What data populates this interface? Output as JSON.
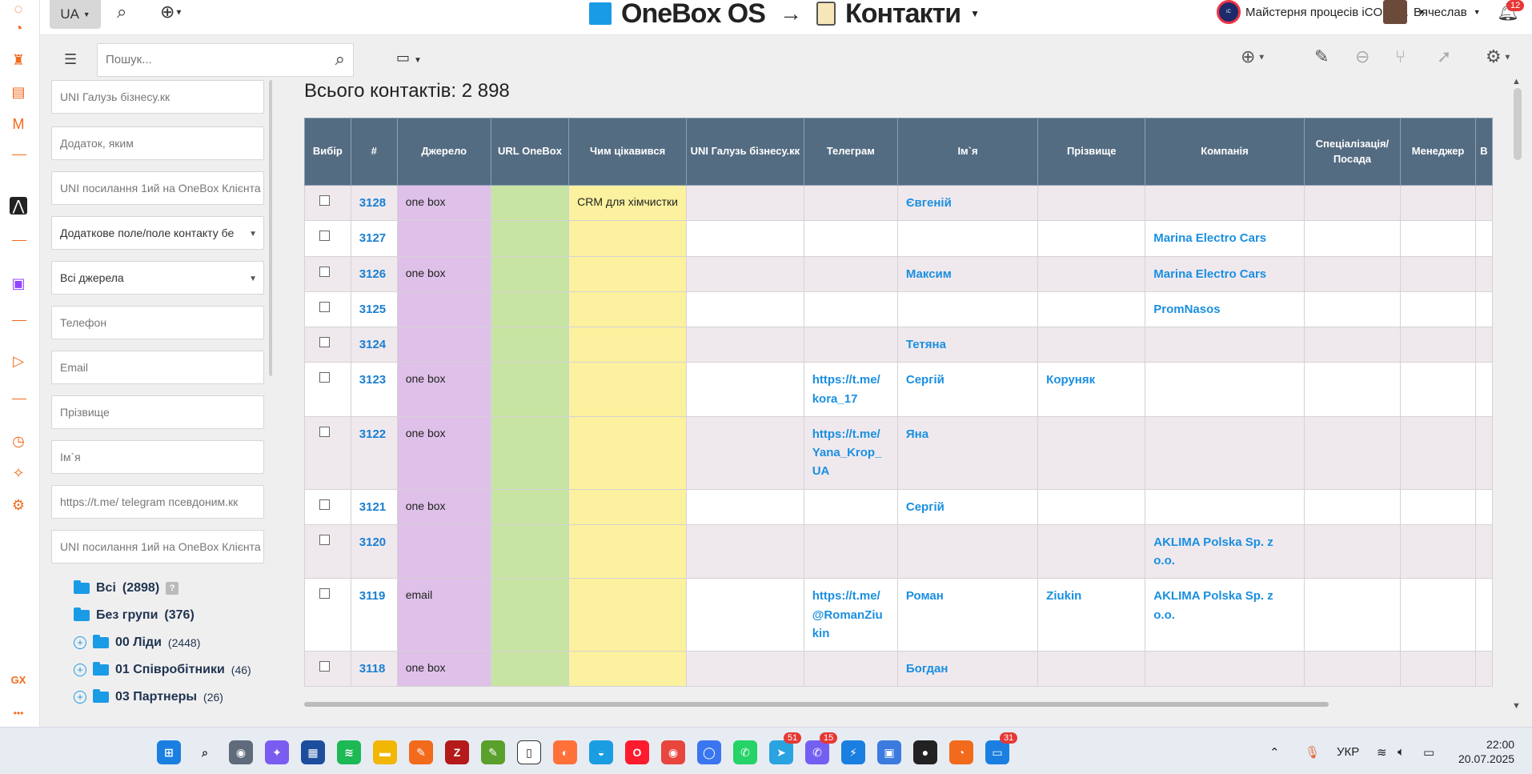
{
  "left_rail": {
    "icons": [
      "dashboard-icon",
      "speed-icon",
      "bag-icon",
      "stripe-icon",
      "mail-icon",
      "logo-icon",
      "twitch-icon",
      "play-icon",
      "clock-icon",
      "puzzle-icon",
      "settings-icon"
    ],
    "bottom_label": "GX",
    "more": "•••"
  },
  "topbar": {
    "lang": "UA",
    "app_name": "OneBox OS",
    "arrow": "→",
    "module": "Контакти",
    "org": "Майстерня процесів iCOLO...",
    "user": "Вячеслав",
    "notifications": "12"
  },
  "toolbar": {
    "search_placeholder": "Пошук..."
  },
  "filters": [
    {
      "text": "UNI Галузь бізнесу.кк",
      "type": "input"
    },
    {
      "text": "Додаток, яким",
      "type": "input"
    },
    {
      "text": "UNI посилання 1ий на OneBox Клієнта",
      "type": "input"
    },
    {
      "text": "Додаткове поле/поле контакту бе",
      "type": "select"
    },
    {
      "text": "Всі джерела",
      "type": "select"
    },
    {
      "text": "Телефон",
      "type": "input"
    },
    {
      "text": "Email",
      "type": "input"
    },
    {
      "text": "Прізвище",
      "type": "input"
    },
    {
      "text": "Ім`я",
      "type": "input"
    },
    {
      "text": "https://t.me/ telegram псевдоним.кк",
      "type": "input"
    },
    {
      "text": "UNI посилання 1ий на OneBox Клієнта",
      "type": "input"
    }
  ],
  "groups": [
    {
      "label": "Всі",
      "count": "(2898)",
      "plus": false,
      "help": "?"
    },
    {
      "label": "Без групи",
      "count": "(376)",
      "plus": false,
      "help": ""
    },
    {
      "label": "00 Ліди",
      "count": "(2448)",
      "plus": true,
      "help": ""
    },
    {
      "label": "01 Співробітники",
      "count": "(46)",
      "plus": true,
      "help": ""
    },
    {
      "label": "03 Партнеры",
      "count": "(26)",
      "plus": true,
      "help": ""
    }
  ],
  "content": {
    "total": "Всього контактів: 2 898",
    "columns": [
      "Вибір",
      "#",
      "Джерело",
      "URL OneBox",
      "Чим цікавився",
      "UNI Галузь бізнесу.кк",
      "Телеграм",
      "Ім`я",
      "Прізвище",
      "Компанія",
      "Спеціалізація/ Посада",
      "Менеджер",
      "В"
    ],
    "rows": [
      {
        "id": "3128",
        "source": "one box",
        "interest": "CRM для хімчистки",
        "telegram": "",
        "name": "Євгеній",
        "surname": "",
        "company": ""
      },
      {
        "id": "3127",
        "source": "",
        "interest": "",
        "telegram": "",
        "name": "",
        "surname": "",
        "company": "Marina Electro Cars"
      },
      {
        "id": "3126",
        "source": "one box",
        "interest": "",
        "telegram": "",
        "name": "Максим",
        "surname": "",
        "company": "Marina Electro Cars"
      },
      {
        "id": "3125",
        "source": "",
        "interest": "",
        "telegram": "",
        "name": "",
        "surname": "",
        "company": "PromNasos"
      },
      {
        "id": "3124",
        "source": "",
        "interest": "",
        "telegram": "",
        "name": "Тетяна",
        "surname": "",
        "company": ""
      },
      {
        "id": "3123",
        "source": "one box",
        "interest": "",
        "telegram": "https://t.me/ kora_17",
        "name": "Сергій",
        "surname": "Коруняк",
        "company": ""
      },
      {
        "id": "3122",
        "source": "one box",
        "interest": "",
        "telegram": "https://t.me/ Yana_Krop_ UA",
        "name": "Яна",
        "surname": "",
        "company": ""
      },
      {
        "id": "3121",
        "source": "one box",
        "interest": "",
        "telegram": "",
        "name": "Сергій",
        "surname": "",
        "company": ""
      },
      {
        "id": "3120",
        "source": "",
        "interest": "",
        "telegram": "",
        "name": "",
        "surname": "",
        "company": "AKLIMA Polska Sp. z o.o."
      },
      {
        "id": "3119",
        "source": "email",
        "interest": "",
        "telegram": "https://t.me/ @RomanZiu kin",
        "name": "Роман",
        "surname": "Ziukin",
        "company": "AKLIMA Polska Sp. z o.o."
      },
      {
        "id": "3118",
        "source": "one box",
        "interest": "",
        "telegram": "",
        "name": "Богдан",
        "surname": "",
        "company": ""
      }
    ]
  },
  "taskbar": {
    "apps": [
      {
        "name": "windows-start-icon",
        "color": "#1a7fe0",
        "glyph": "⊞",
        "badge": ""
      },
      {
        "name": "search-icon",
        "color": "transparent",
        "glyph": "⌕",
        "badge": ""
      },
      {
        "name": "camera-icon",
        "color": "#5f6b7a",
        "glyph": "◉",
        "badge": ""
      },
      {
        "name": "copilot-icon",
        "color": "#7b5cf0",
        "glyph": "✦",
        "badge": ""
      },
      {
        "name": "store-icon",
        "color": "#1d4e9e",
        "glyph": "▦",
        "badge": ""
      },
      {
        "name": "spotify-icon",
        "color": "#1db954",
        "glyph": "≋",
        "badge": ""
      },
      {
        "name": "explorer-icon",
        "color": "#f2b705",
        "glyph": "▬",
        "badge": ""
      },
      {
        "name": "pen-icon",
        "color": "#f26a1b",
        "glyph": "✎",
        "badge": ""
      },
      {
        "name": "filezilla-icon",
        "color": "#b41a1a",
        "glyph": "Z",
        "badge": ""
      },
      {
        "name": "notepad-icon",
        "color": "#5aa02c",
        "glyph": "✎",
        "badge": ""
      },
      {
        "name": "file-icon",
        "color": "#ffffff",
        "glyph": "▯",
        "badge": ""
      },
      {
        "name": "firefox-icon",
        "color": "#ff7139",
        "glyph": "◐",
        "badge": ""
      },
      {
        "name": "edge-icon",
        "color": "#1b9de2",
        "glyph": "◒",
        "badge": ""
      },
      {
        "name": "opera-icon",
        "color": "#ff1b2d",
        "glyph": "O",
        "badge": ""
      },
      {
        "name": "chrome-icon",
        "color": "#e8453c",
        "glyph": "◉",
        "badge": ""
      },
      {
        "name": "signal-icon",
        "color": "#3a76f0",
        "glyph": "◯",
        "badge": ""
      },
      {
        "name": "whatsapp-icon",
        "color": "#25d366",
        "glyph": "✆",
        "badge": ""
      },
      {
        "name": "telegram-icon",
        "color": "#2aa3e0",
        "glyph": "➤",
        "badge": "51"
      },
      {
        "name": "viber-icon",
        "color": "#7360f2",
        "glyph": "✆",
        "badge": "15"
      },
      {
        "name": "app-blue-icon",
        "color": "#1a7fe0",
        "glyph": "⚡",
        "badge": ""
      },
      {
        "name": "app-save-icon",
        "color": "#3b7be0",
        "glyph": "▣",
        "badge": ""
      },
      {
        "name": "recorder-icon",
        "color": "#222222",
        "glyph": "●",
        "badge": ""
      },
      {
        "name": "speed-app-icon",
        "color": "#f26a1b",
        "glyph": "◔",
        "badge": ""
      },
      {
        "name": "remote-icon",
        "color": "#1a7fe0",
        "glyph": "▭",
        "badge": "31"
      }
    ],
    "tray": {
      "lang": "УКР"
    },
    "time": "22:00",
    "date": "20.07.2025"
  }
}
